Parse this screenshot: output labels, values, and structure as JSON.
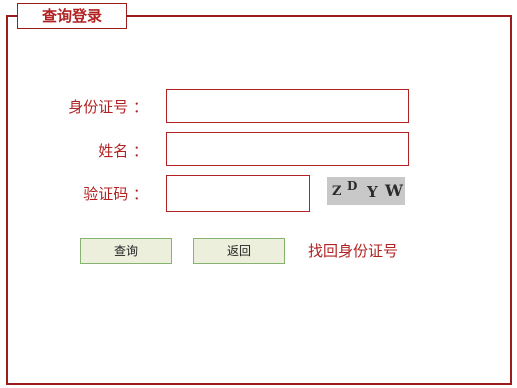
{
  "panel": {
    "title": "查询登录"
  },
  "form": {
    "id_label": "身份证号 ：",
    "id_value": "",
    "name_label": "姓名 ：",
    "name_value": "",
    "captcha_label": "验证码 ：",
    "captcha_value": "",
    "captcha_chars": [
      "Z",
      "D",
      "Y",
      "W"
    ]
  },
  "actions": {
    "query_label": "查询",
    "back_label": "返回",
    "recover_label": "找回身份证号"
  },
  "colors": {
    "accent": "#b22222",
    "border": "#9b1c1c",
    "button_bg": "#ecefdc",
    "button_border": "#86b470",
    "captcha_bg": "#c8c8c8"
  }
}
